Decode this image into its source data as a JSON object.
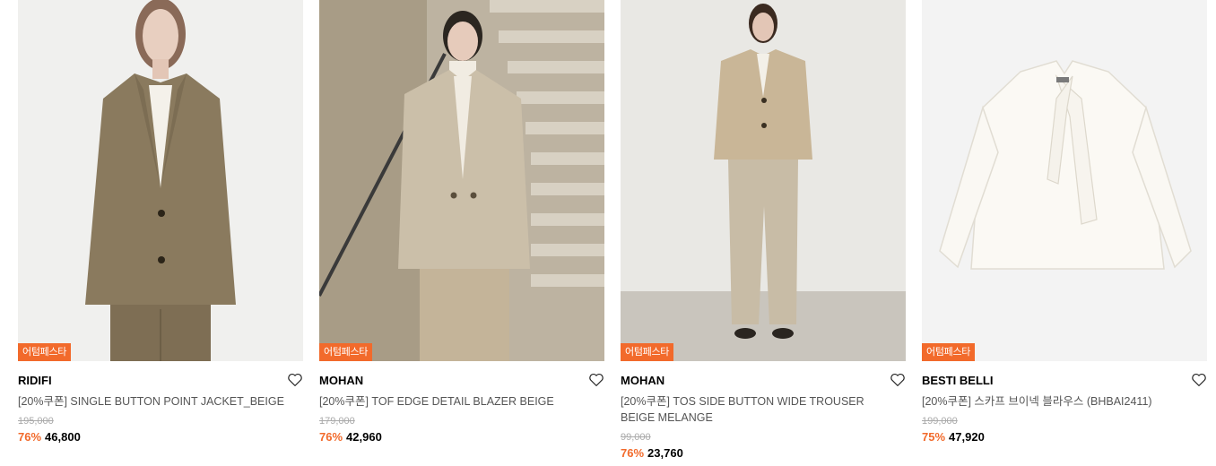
{
  "products": [
    {
      "badge": "어텀페스타",
      "brand": "RIDIFI",
      "name": "[20%쿠폰] SINGLE BUTTON POINT JACKET_BEIGE",
      "original_price": "195,000",
      "discount": "76%",
      "price": "46,800"
    },
    {
      "badge": "어텀페스타",
      "brand": "MOHAN",
      "name": "[20%쿠폰] TOF EDGE DETAIL BLAZER BEIGE",
      "original_price": "179,000",
      "discount": "76%",
      "price": "42,960"
    },
    {
      "badge": "어텀페스타",
      "brand": "MOHAN",
      "name": "[20%쿠폰] TOS SIDE BUTTON WIDE TROUSER BEIGE MELANGE",
      "original_price": "99,000",
      "discount": "76%",
      "price": "23,760"
    },
    {
      "badge": "어텀페스타",
      "brand": "BESTI BELLI",
      "name": "[20%쿠폰] 스카프 브이넥 블라우스 (BHBAI2411)",
      "original_price": "199,000",
      "discount": "75%",
      "price": "47,920"
    }
  ],
  "colors": {
    "accent": "#f26a2b",
    "text": "#000000",
    "muted": "#555555",
    "strike": "#aaaaaa"
  }
}
